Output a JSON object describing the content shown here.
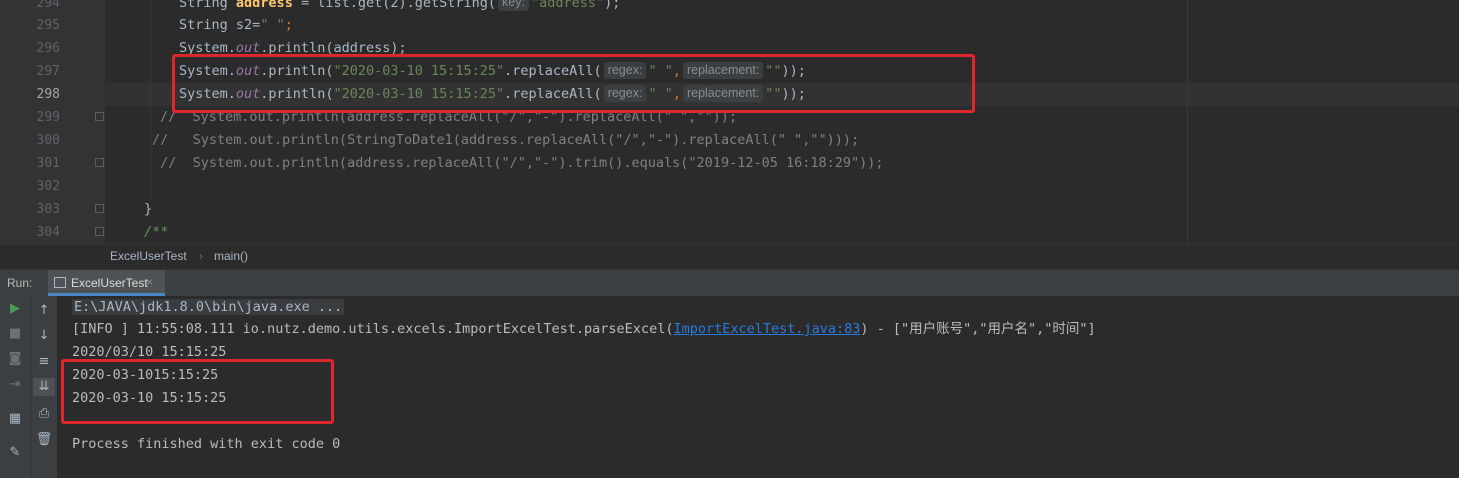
{
  "editor": {
    "lines": [
      {
        "num": "294",
        "text": "String address = list.get(2).getString( key: \"address\");"
      },
      {
        "num": "295",
        "text": "String s2=\" \";"
      },
      {
        "num": "296",
        "text": "System.out.println(address);"
      },
      {
        "num": "297",
        "text": "System.out.println(\"2020-03-10 15:15:25\".replaceAll( regex: \" \", replacement: \"\"));"
      },
      {
        "num": "298",
        "text": "System.out.println(\"2020-03-10 15:15:25\".replaceAll( regex: \" \", replacement: \"\"));"
      },
      {
        "num": "299",
        "text": "//  System.out.println(address.replaceAll(\"/\",\"-\").replaceAll(\" \",\"\"));"
      },
      {
        "num": "300",
        "text": "//   System.out.println(StringToDate1(address.replaceAll(\"/\",\"-\").replaceAll(\" \",\"\")));"
      },
      {
        "num": "301",
        "text": "//  System.out.println(address.replaceAll(\"/\",\"-\").trim().equals(\"2019-12-05 16:18:29\"));"
      },
      {
        "num": "302",
        "text": ""
      },
      {
        "num": "303",
        "text": "}"
      },
      {
        "num": "304",
        "text": "/**"
      }
    ],
    "tokens": {
      "string_kw": "String",
      "address_var": "address",
      "list_get": " = list.get(2).getString(",
      "key_hint": "key:",
      "address_str": "\"address\"",
      "close_semi": ");",
      "s2_decl": "s2=",
      "space_str": "\" \"",
      "semi": ";",
      "system": "System.",
      "out": "out",
      "println_open": ".println(",
      "println_address": "address",
      "close_paren_semi": ");",
      "date_str": "\"2020-03-10 15:15:25\"",
      "replace_all": ".replaceAll(",
      "regex_hint": "regex:",
      "comma": ",",
      "replacement_hint": "replacement:",
      "empty_str": "\"\"",
      "end_call": "));",
      "comment_299": "//  System.out.println(address.replaceAll(\"/\",\"-\").replaceAll(\" \",\"\"));",
      "comment_300": "//   System.out.println(StringToDate1(address.replaceAll(\"/\",\"-\").replaceAll(\" \",\"\")));",
      "comment_301": " //  System.out.println(address.replaceAll(\"/\",\"-\").trim().equals(\"2019-12-05 16:18:29\"));",
      "brace_close": "}",
      "doc_open": "/**"
    }
  },
  "breadcrumb": {
    "class_name": "ExcelUserTest",
    "separator": "›",
    "method_name": "main()"
  },
  "run_panel": {
    "label": "Run:",
    "tab_label": "ExcelUserTest",
    "tab_close": "×"
  },
  "console": {
    "command": "E:\\JAVA\\jdk1.8.0\\bin\\java.exe ...",
    "info_prefix": "[INFO ] 11:55:08.111 io.nutz.demo.utils.excels.ImportExcelTest.parseExcel(",
    "info_link": "ImportExcelTest.java:83",
    "info_suffix": ") - [\"用户账号\",\"用户名\",\"时间\"]",
    "out1": "2020/03/10 15:15:25",
    "out2": "2020-03-1015:15:25",
    "out3": "2020-03-10 15:15:25",
    "finished": "Process finished with exit code 0"
  },
  "colors": {
    "highlight_box": "#e0262a",
    "background": "#2b2b2b",
    "link": "#287bde"
  }
}
